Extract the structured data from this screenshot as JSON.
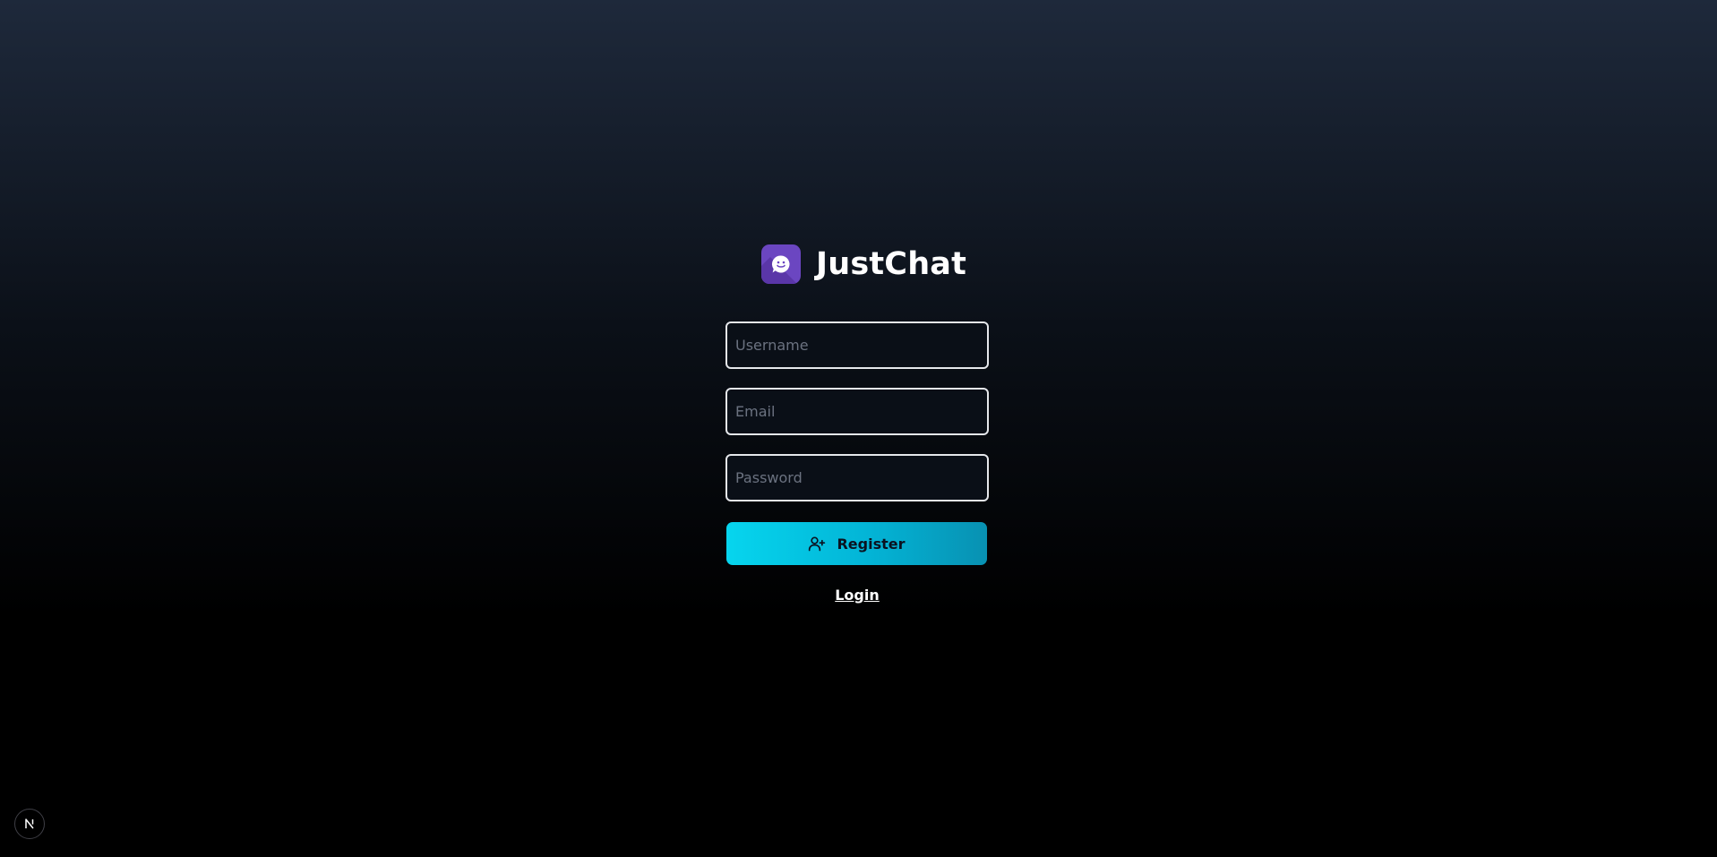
{
  "app": {
    "name": "JustChat",
    "logo_icon": "chat-bubble-smile-icon"
  },
  "form": {
    "username_placeholder": "Username",
    "username_value": "",
    "email_placeholder": "Email",
    "email_value": "",
    "password_placeholder": "Password",
    "password_value": "",
    "register_label": "Register",
    "register_icon": "user-plus-icon",
    "login_link": "Login"
  },
  "dev_badge": {
    "icon": "nextjs-logo-icon"
  },
  "colors": {
    "accent": "#06d5ee",
    "accent_dark": "#0891b2",
    "logo_bg": "#6b46c1",
    "background_top": "#1e293b",
    "background_bottom": "#000000"
  }
}
